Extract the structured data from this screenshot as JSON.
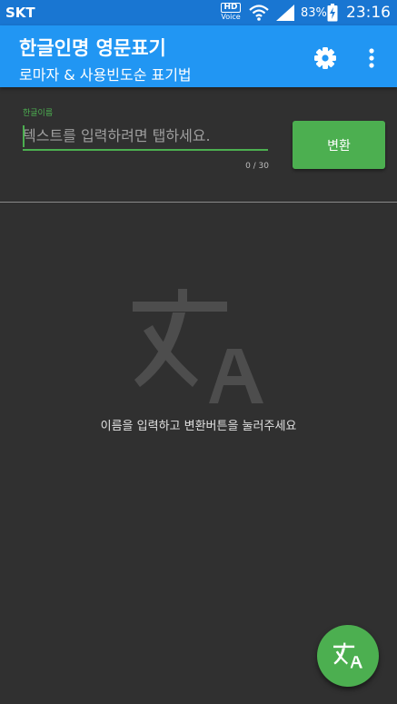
{
  "status_bar": {
    "carrier": "SKT",
    "hd_top": "HD",
    "hd_bottom": "Voice",
    "battery": "83%",
    "time": "23:16"
  },
  "app_bar": {
    "title": "한글인명 영문표기",
    "subtitle": "로마자 & 사용빈도순 표기법",
    "settings_icon": "gear-icon",
    "menu_icon": "more-vert-icon"
  },
  "form": {
    "label": "한글이름",
    "value": "",
    "placeholder": "텍스트를 입력하려면 탭하세요.",
    "counter": "0 / 30",
    "convert_label": "변환"
  },
  "empty_state": {
    "icon": "translate-icon",
    "message": "이름을 입력하고 변환버튼을 눌러주세요"
  },
  "fab": {
    "icon": "translate-icon"
  },
  "colors": {
    "status_bar": "#1976d2",
    "app_bar": "#2196f3",
    "accent": "#4caf50",
    "background": "#303030"
  }
}
